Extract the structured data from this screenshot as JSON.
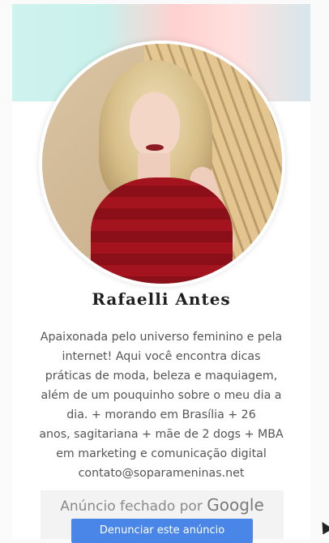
{
  "profile": {
    "name": "Rafaelli Antes",
    "bio_lines": [
      "Apaixonada pelo universo feminino e pela",
      "internet! Aqui você encontra dicas",
      "práticas de moda, beleza e maquiagem,",
      "além de um pouquinho sobre o meu dia a",
      "dia. + morando em Brasília + 26",
      "anos, sagitariana + mãe de 2 dogs + MBA",
      "em marketing e comunicação digital",
      "contato@soparameninas.net"
    ]
  },
  "ad": {
    "closed_text": "Anúncio fechado por",
    "brand": "Google",
    "report_button": "Denunciar este anúncio"
  },
  "colors": {
    "accent": "#4a86e8",
    "banner_left": "#cff3ef",
    "banner_right": "#ffd1cf"
  }
}
